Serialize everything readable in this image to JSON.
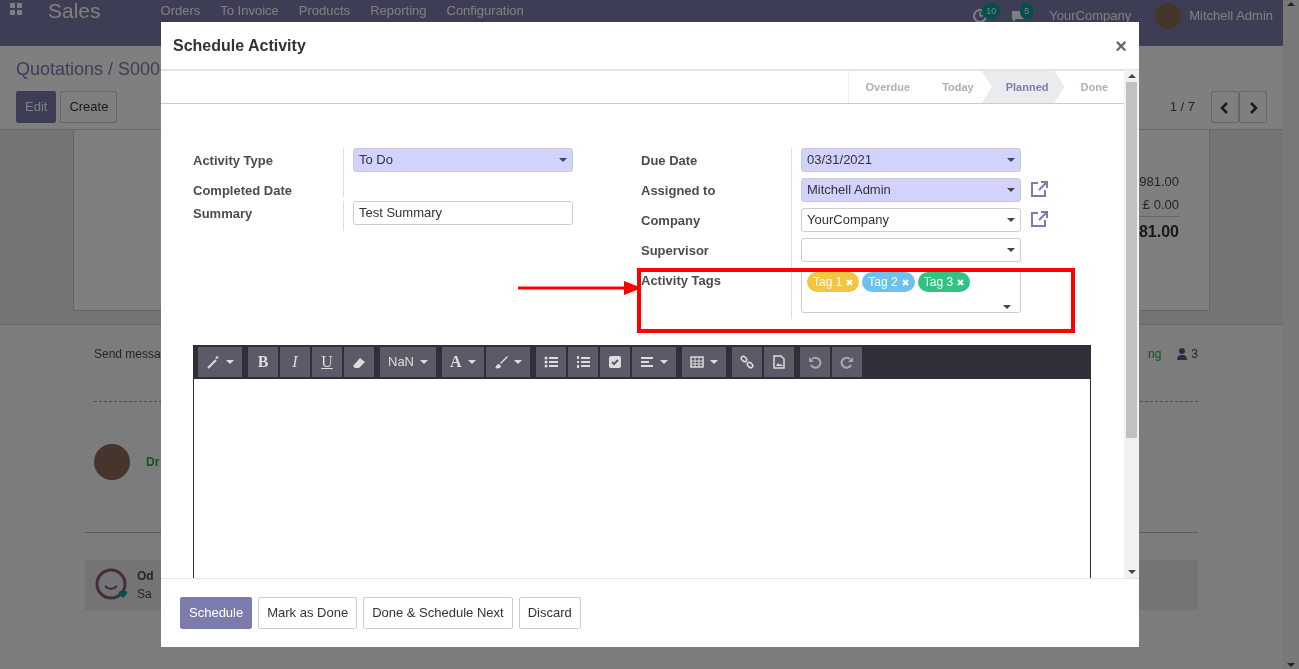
{
  "navbar": {
    "app_name": "Sales",
    "menu": [
      "Orders",
      "To Invoice",
      "Products",
      "Reporting",
      "Configuration"
    ],
    "activity_count": "10",
    "message_count": "5",
    "company": "YourCompany",
    "user": "Mitchell Admin"
  },
  "control_panel": {
    "breadcrumb": "Quotations / S000",
    "buttons": [
      {
        "label": "Edit",
        "kind": "primary"
      },
      {
        "label": "Create",
        "kind": "secondary"
      }
    ],
    "pager": "1 / 7"
  },
  "sheet": {
    "amounts": [
      "981.00",
      "£ 0.00"
    ],
    "total": "81.00"
  },
  "chatter": {
    "send_message": "Send messa",
    "activity_link": "ng",
    "followers": "3",
    "author": "Dr",
    "notification": {
      "title": "Od",
      "text": "Sa"
    }
  },
  "modal": {
    "title": "Schedule Activity",
    "close": "×",
    "stages": [
      {
        "label": "Overdue",
        "selected": false
      },
      {
        "label": "Today",
        "selected": false
      },
      {
        "label": "Planned",
        "selected": true
      },
      {
        "label": "Done",
        "selected": false
      }
    ],
    "left_fields": [
      {
        "label": "Activity Type",
        "kind": "select",
        "value": "To Do",
        "required": true
      },
      {
        "label": "Completed Date",
        "kind": "none"
      },
      {
        "label": "Summary",
        "kind": "text",
        "value": "Test Summary"
      }
    ],
    "right_fields": [
      {
        "label": "Due Date",
        "kind": "select",
        "value": "03/31/2021",
        "required": true
      },
      {
        "label": "Assigned to",
        "kind": "select",
        "value": "Mitchell Admin",
        "required": true,
        "external_link": true
      },
      {
        "label": "Company",
        "kind": "select",
        "value": "YourCompany",
        "external_link": true
      },
      {
        "label": "Supervisor",
        "kind": "select"
      },
      {
        "label": "Activity Tags",
        "kind": "tags",
        "tags": [
          {
            "label": "Tag 1",
            "color": "#f4c542"
          },
          {
            "label": "Tag 2",
            "color": "#6cc1ed"
          },
          {
            "label": "Tag 3",
            "color": "#30c381"
          }
        ],
        "highlighted": true
      }
    ],
    "editor": {
      "style_buttons": [
        "B",
        "I",
        "U"
      ],
      "font_size": "NaN",
      "color_button": "A"
    },
    "buttons": [
      {
        "label": "Schedule",
        "kind": "primary"
      },
      {
        "label": "Mark as Done",
        "kind": "secondary"
      },
      {
        "label": "Done & Schedule Next",
        "kind": "secondary"
      },
      {
        "label": "Discard",
        "kind": "secondary"
      }
    ]
  }
}
